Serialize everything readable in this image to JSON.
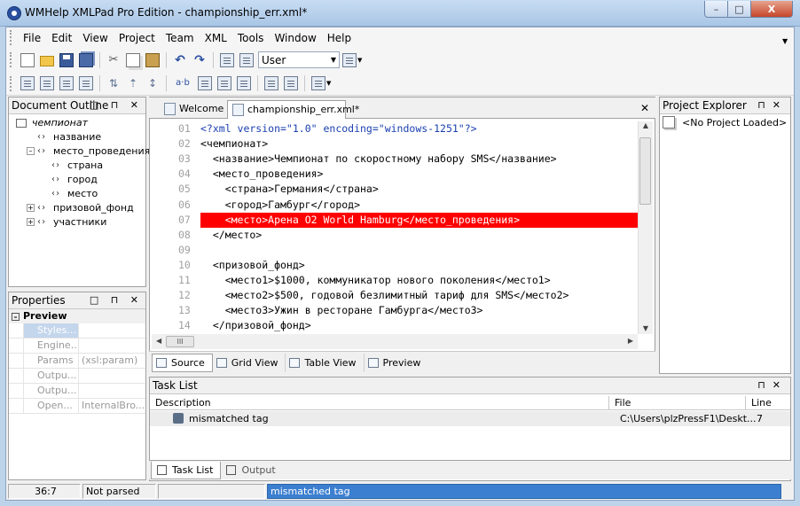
{
  "window": {
    "title": "WMHelp XMLPad Pro Edition - championship_err.xml*",
    "min_glyph": "–",
    "max_glyph": "□",
    "close_glyph": "X"
  },
  "menu": [
    "File",
    "Edit",
    "View",
    "Project",
    "Team",
    "XML",
    "Tools",
    "Window",
    "Help"
  ],
  "toolbar": {
    "user_select": "User",
    "text_icon": "a·b"
  },
  "outline": {
    "title": "Document Outline",
    "header_buttons": "□ ⊓ ✕",
    "items": [
      {
        "label": "чемпионат",
        "level": 0,
        "expander": ""
      },
      {
        "label": "название",
        "level": 1,
        "expander": ""
      },
      {
        "label": "место_проведения",
        "level": 1,
        "expander": "–"
      },
      {
        "label": "страна",
        "level": 2,
        "expander": ""
      },
      {
        "label": "город",
        "level": 2,
        "expander": ""
      },
      {
        "label": "место",
        "level": 2,
        "expander": ""
      },
      {
        "label": "призовой_фонд",
        "level": 1,
        "expander": "+"
      },
      {
        "label": "участники",
        "level": 1,
        "expander": "+"
      }
    ]
  },
  "properties": {
    "title": "Properties",
    "category": "Preview",
    "rows": [
      {
        "name": "Styles...",
        "value": ""
      },
      {
        "name": "Engine...",
        "value": ""
      },
      {
        "name": "Params",
        "value": "(xsl:param)"
      },
      {
        "name": "Outpu...",
        "value": ""
      },
      {
        "name": "Outpu...",
        "value": ""
      },
      {
        "name": "Open...",
        "value": "InternalBro..."
      }
    ]
  },
  "editor": {
    "tabs": [
      "Welcome",
      "championship_err.xml*"
    ],
    "close_glyph": "✕",
    "lines": [
      {
        "n": "01",
        "text": "<?xml version=\"1.0\" encoding=\"windows-1251\"?>"
      },
      {
        "n": "02",
        "text": "<чемпионат>"
      },
      {
        "n": "03",
        "text": "  <название>Чемпионат по скоростному набору SMS</название>"
      },
      {
        "n": "04",
        "text": "  <место_проведения>"
      },
      {
        "n": "05",
        "text": "    <страна>Германия</страна>"
      },
      {
        "n": "06",
        "text": "    <город>Гамбург</город>"
      },
      {
        "n": "07",
        "text": "    <место>Арена O2 World Hamburg</место_проведения>"
      },
      {
        "n": "08",
        "text": "  </место>"
      },
      {
        "n": "09",
        "text": ""
      },
      {
        "n": "10",
        "text": "  <призовой_фонд>"
      },
      {
        "n": "11",
        "text": "    <место1>$1000, коммуникатор нового поколения</место1>"
      },
      {
        "n": "12",
        "text": "    <место2>$500, годовой безлимитный тариф для SMS</место2>"
      },
      {
        "n": "13",
        "text": "    <место3>Ужин в ресторане Гамбурга</место3>"
      },
      {
        "n": "14",
        "text": "  </призовой_фонд>"
      }
    ],
    "error_line": "07",
    "hscroll_thumb": "III",
    "view_tabs": [
      "Source",
      "Grid View",
      "Table View",
      "Preview"
    ]
  },
  "project": {
    "title": "Project Explorer",
    "empty": "<No Project Loaded>"
  },
  "tasks": {
    "title": "Task List",
    "columns": [
      "Description",
      "File",
      "Line"
    ],
    "rows": [
      {
        "description": "mismatched tag",
        "file": "C:\\Users\\plzPressF1\\Deskt...",
        "line": "7"
      }
    ],
    "tabs": [
      "Task List",
      "Output"
    ]
  },
  "status": {
    "position": "36:7",
    "parse_state": "Not parsed",
    "empty_cell": "",
    "message": "mismatched tag"
  }
}
